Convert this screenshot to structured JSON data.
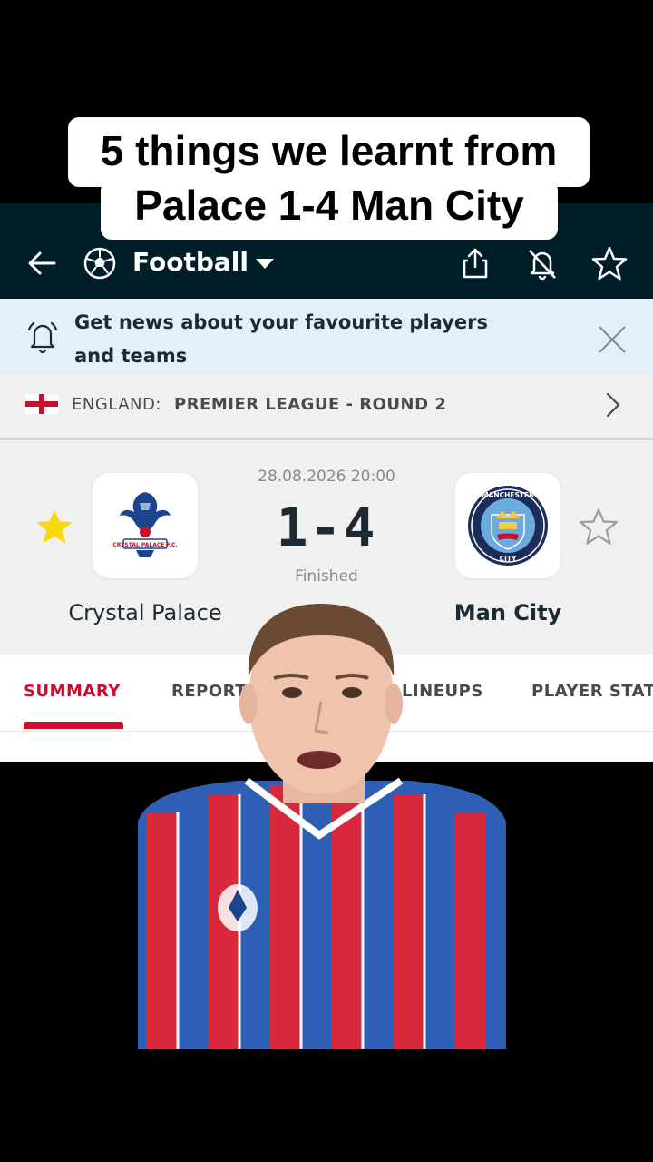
{
  "caption": {
    "line1": "5 things we learnt from",
    "line2": "Palace 1-4 Man City"
  },
  "topbar": {
    "back_icon": "arrow-left-icon",
    "sport_icon": "soccer-ball-icon",
    "sport_label": "Football",
    "dropdown_icon": "caret-down-icon",
    "share_icon": "share-icon",
    "notifications_icon": "bell-off-icon",
    "favourite_icon": "star-outline-icon"
  },
  "banner": {
    "icon": "bell-ringing-icon",
    "text": "Get news about your favourite players and teams",
    "close_icon": "close-icon"
  },
  "league": {
    "flag": "england-flag-icon",
    "country": "ENGLAND:",
    "name": "PREMIER LEAGUE - ROUND 2",
    "chevron": "chevron-right-icon"
  },
  "match": {
    "date": "28.08.2026 20:00",
    "score": "1-4",
    "status": "Finished",
    "home": {
      "name": "Crystal Palace",
      "favourite": true,
      "crest_text": "CRYSTAL PALACE F.C."
    },
    "away": {
      "name": "Man City",
      "favourite": false,
      "crest_text": "MANCHESTER CITY"
    }
  },
  "tabs": [
    {
      "label": "SUMMARY",
      "active": true
    },
    {
      "label": "REPORT",
      "active": false
    },
    {
      "label": "LINEUPS",
      "active": false
    },
    {
      "label": "PLAYER STATS",
      "active": false
    }
  ],
  "colors": {
    "topbar": "#001e28",
    "accent": "#c8102e",
    "banner": "#e3eff9",
    "star_active": "#f5d90a"
  }
}
